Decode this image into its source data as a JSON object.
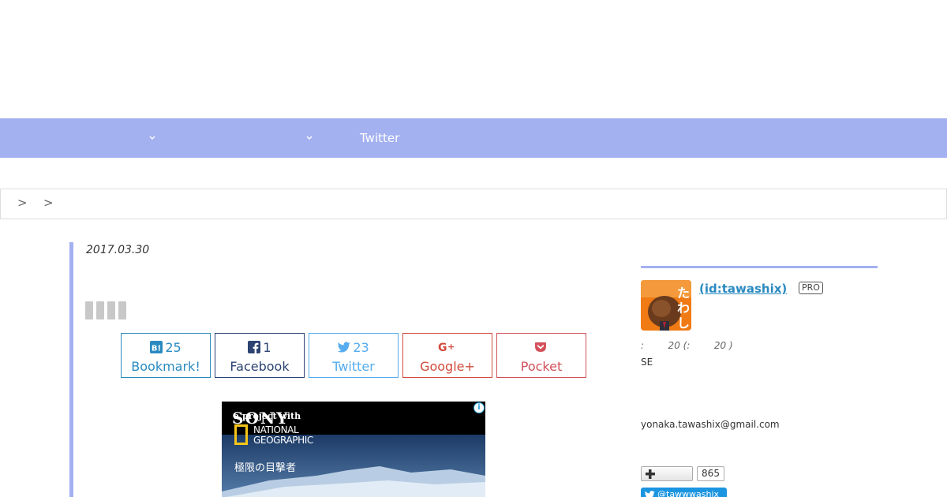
{
  "nav": {
    "items": [
      {
        "label": ""
      },
      {
        "label": ""
      },
      {
        "label": "Twitter"
      }
    ]
  },
  "breadcrumb": {
    "links": [
      "",
      ""
    ],
    "separator": ">"
  },
  "article": {
    "date": "2017.03.30"
  },
  "share": {
    "hatena": {
      "count": "25",
      "label": "Bookmark!",
      "color": "#2a8ac0"
    },
    "facebook": {
      "count": "1",
      "label": "Facebook",
      "color": "#2d4373"
    },
    "twitter": {
      "count": "23",
      "label": "Twitter",
      "color": "#55acee"
    },
    "google": {
      "count": "",
      "label": "Google+",
      "color": "#d24b3c"
    },
    "pocket": {
      "count": "",
      "label": "Pocket",
      "color": "#d3505a"
    }
  },
  "ad": {
    "brand": "SONY",
    "tagline": "a project with",
    "partner": "NATIONAL\nGEOGRAPHIC",
    "caption": "極限の目撃者"
  },
  "profile": {
    "name": " (id:tawashix)",
    "badge": "PRO",
    "stats": ":        20 (:        20 )",
    "bio": "SE",
    "email": "yonaka.tawashix@gmail.com",
    "follower_count": "865",
    "twitter_handle": "@tawwwashix"
  },
  "colors": {
    "accent": "#a3b1f0",
    "link": "#2a8ac0"
  }
}
